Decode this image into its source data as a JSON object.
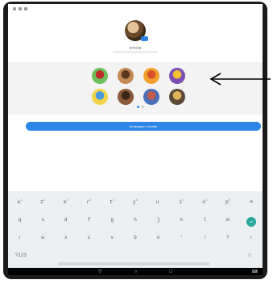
{
  "status_bar": {
    "left_text": "",
    "right_time": "",
    "right_extra": ""
  },
  "profile": {
    "name_value": "orinoia"
  },
  "avatars": [
    {
      "icon": "mario-avatar-icon",
      "bg": "#6fbf5f",
      "fg": "#c02b2b"
    },
    {
      "icon": "girl-avatar-icon",
      "bg": "#c48a55",
      "fg": "#5a3520"
    },
    {
      "icon": "fox-avatar-icon",
      "bg": "#f0a12b",
      "fg": "#d9502a"
    },
    {
      "icon": "purple-avatar-icon",
      "bg": "#7b4fb3",
      "fg": "#f1c232"
    },
    {
      "icon": "blonde-avatar-icon",
      "bg": "#f2d44a",
      "fg": "#4a9be0"
    },
    {
      "icon": "brown-avatar-icon",
      "bg": "#8a5a3a",
      "fg": "#3a2618"
    },
    {
      "icon": "eye-avatar-icon",
      "bg": "#4a6fb8",
      "fg": "#c25b4a"
    },
    {
      "icon": "dark-avatar-icon",
      "bg": "#5b4a3a",
      "fg": "#e0b25c"
    }
  ],
  "cta_label": "Анимация и Avatar",
  "keyboard": {
    "row1": [
      "а",
      "z",
      "е",
      "r",
      "t",
      "y",
      "u",
      "i",
      "o",
      "p",
      "⌫"
    ],
    "row1_sub": [
      "1",
      "2",
      "3",
      "4",
      "5",
      "6",
      "7",
      "8",
      "9",
      "0",
      ""
    ],
    "row2": [
      "q",
      "s",
      "d",
      "f",
      "g",
      "h",
      "j",
      "k",
      "l",
      "m",
      "↵"
    ],
    "row3": [
      "⇧",
      "w",
      "x",
      "c",
      "v",
      "b",
      "n",
      "'",
      "!",
      "?",
      "⇧"
    ],
    "row4_left": "?123",
    "row4_right": "☺"
  },
  "navbar": {
    "back": "▽",
    "home": "○",
    "recents": "□",
    "keyboard": "⌨"
  },
  "colors": {
    "accent": "#2d86e6",
    "enter": "#27a89a"
  }
}
